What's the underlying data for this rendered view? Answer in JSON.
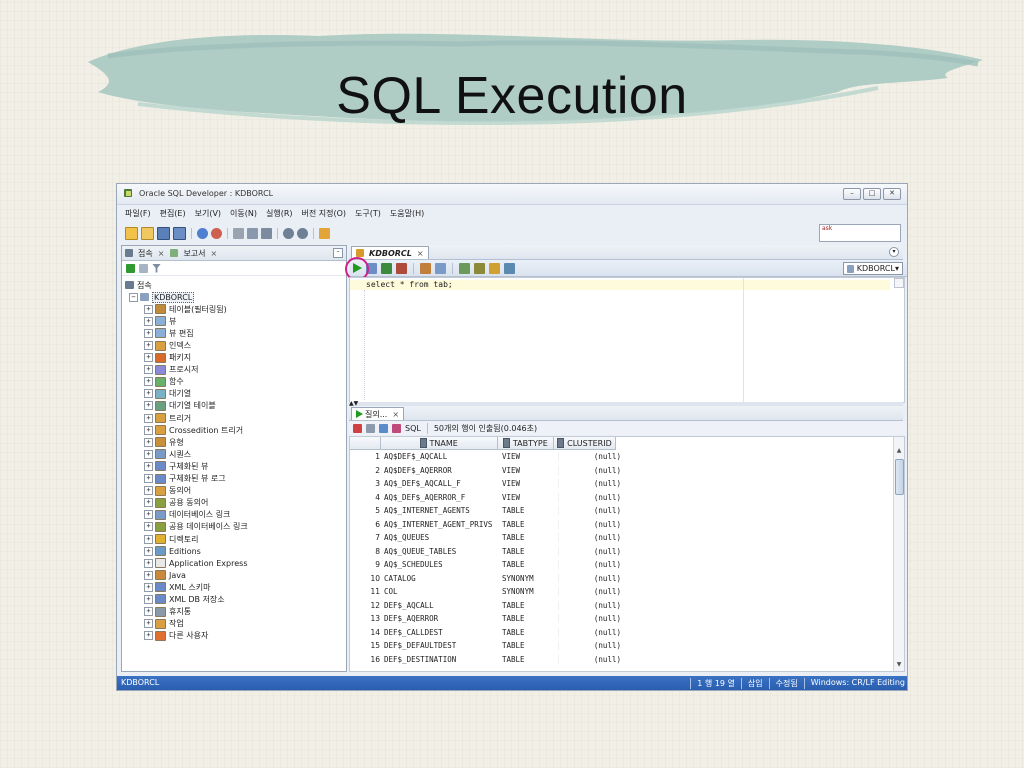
{
  "slide": {
    "title": "SQL Execution"
  },
  "app": {
    "window_title": "Oracle SQL Developer : KDBORCL",
    "window_buttons": [
      "–",
      "□",
      "✕"
    ],
    "menu": [
      "파일(F)",
      "편집(E)",
      "보기(V)",
      "이동(N)",
      "실행(R)",
      "버전 지정(O)",
      "도구(T)",
      "도움말(H)"
    ],
    "memory_widget_label": "ask"
  },
  "left_panel": {
    "tabs": [
      {
        "label": "접속",
        "close": "×"
      },
      {
        "label": "보고서",
        "close": "×"
      }
    ],
    "minimize": "–",
    "root": "접속",
    "connection": "KDBORCL",
    "expander": "+",
    "collapser": "−",
    "items": [
      "테이블(필터링됨)",
      "뷰",
      "뷰 편집",
      "인덱스",
      "패키지",
      "프로시저",
      "함수",
      "대기열",
      "대기열 테이블",
      "트리거",
      "Crossedition 트리거",
      "유형",
      "시퀀스",
      "구체화된 뷰",
      "구체화된 뷰 로그",
      "동의어",
      "공용 동의어",
      "데이터베이스 링크",
      "공용 데이터베이스 링크",
      "디렉토리",
      "Editions",
      "Application Express",
      "Java",
      "XML 스키마",
      "XML DB 저장소",
      "휴지통",
      "작업",
      "다른 사용자"
    ]
  },
  "editor": {
    "tab_label": "KDBORCL",
    "tab_close": "×",
    "connection_selector": "KDBORCL▾",
    "sql_text": "select * from tab;",
    "splitter_arrows": "▲▼"
  },
  "results": {
    "tab_label": "질의...",
    "tab_close": "×",
    "sql_label": "SQL",
    "status_message": "50개의 행이 인출됨(0.046초)",
    "columns": [
      "TNAME",
      "TABTYPE",
      "CLUSTERID"
    ],
    "rows": [
      [
        "1",
        "AQ$DEF$_AQCALL",
        "VIEW",
        "(null)"
      ],
      [
        "2",
        "AQ$DEF$_AQERROR",
        "VIEW",
        "(null)"
      ],
      [
        "3",
        "AQ$_DEF$_AQCALL_F",
        "VIEW",
        "(null)"
      ],
      [
        "4",
        "AQ$_DEF$_AQERROR_F",
        "VIEW",
        "(null)"
      ],
      [
        "5",
        "AQ$_INTERNET_AGENTS",
        "TABLE",
        "(null)"
      ],
      [
        "6",
        "AQ$_INTERNET_AGENT_PRIVS",
        "TABLE",
        "(null)"
      ],
      [
        "7",
        "AQ$_QUEUES",
        "TABLE",
        "(null)"
      ],
      [
        "8",
        "AQ$_QUEUE_TABLES",
        "TABLE",
        "(null)"
      ],
      [
        "9",
        "AQ$_SCHEDULES",
        "TABLE",
        "(null)"
      ],
      [
        "10",
        "CATALOG",
        "SYNONYM",
        "(null)"
      ],
      [
        "11",
        "COL",
        "SYNONYM",
        "(null)"
      ],
      [
        "12",
        "DEF$_AQCALL",
        "TABLE",
        "(null)"
      ],
      [
        "13",
        "DEF$_AQERROR",
        "TABLE",
        "(null)"
      ],
      [
        "14",
        "DEF$_CALLDEST",
        "TABLE",
        "(null)"
      ],
      [
        "15",
        "DEF$_DEFAULTDEST",
        "TABLE",
        "(null)"
      ],
      [
        "16",
        "DEF$_DESTINATION",
        "TABLE",
        "(null)"
      ]
    ],
    "scroll_up": "▲",
    "scroll_down": "▼"
  },
  "statusbar": {
    "left": "KDBORCL",
    "right": [
      "1 행 19 열",
      "삽입",
      "수정됨",
      "Windows: CR/LF Editing"
    ]
  },
  "colors": {
    "accent_blue": "#2a5eaf",
    "highlight_circle": "#d0208a",
    "run_green": "#1f9a1f",
    "brush": "#a9c9c2"
  }
}
